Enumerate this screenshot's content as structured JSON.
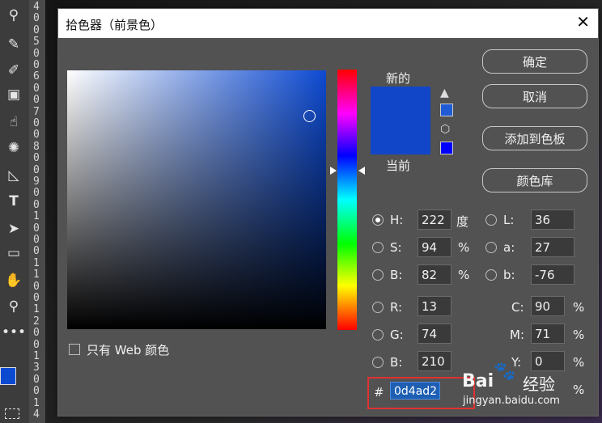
{
  "dialog": {
    "title": "拾色器（前景色）",
    "close": "✕"
  },
  "preview": {
    "new_label": "新的",
    "current_label": "当前",
    "new_color": "#1146c8",
    "current_color": "#1146c8",
    "warning_swatch": "#1f5bd4",
    "websafe_swatch": "#0000ff"
  },
  "buttons": {
    "ok": "确定",
    "cancel": "取消",
    "add_swatch": "添加到色板",
    "color_library": "颜色库"
  },
  "hsb": {
    "h_label": "H:",
    "h_value": "222",
    "h_unit": "度",
    "s_label": "S:",
    "s_value": "94",
    "s_unit": "%",
    "b_label": "B:",
    "b_value": "82",
    "b_unit": "%"
  },
  "lab": {
    "l_label": "L:",
    "l_value": "36",
    "a_label": "a:",
    "a_value": "27",
    "b_label": "b:",
    "b_value": "-76"
  },
  "rgb": {
    "r_label": "R:",
    "r_value": "13",
    "g_label": "G:",
    "g_value": "74",
    "b_label": "B:",
    "b_value": "210"
  },
  "cmyk": {
    "c_label": "C:",
    "c_value": "90",
    "c_unit": "%",
    "m_label": "M:",
    "m_value": "71",
    "m_unit": "%",
    "y_label": "Y:",
    "y_value": "0",
    "y_unit": "%",
    "k_unit": "%"
  },
  "hex": {
    "label": "#",
    "value": "0d4ad2"
  },
  "web_only": {
    "label": "只有 Web 颜色"
  },
  "ruler": {
    "marks": [
      "4",
      "0",
      "0",
      "5",
      "0",
      "0",
      "6",
      "0",
      "0",
      "7",
      "0",
      "0",
      "8",
      "0",
      "0",
      "9",
      "0",
      "0",
      "1",
      "0",
      "0",
      "0",
      "1",
      "1",
      "0",
      "0",
      "1",
      "2",
      "0",
      "0",
      "1",
      "3",
      "0",
      "0",
      "1",
      "4"
    ]
  },
  "watermark": {
    "brand": "Bai",
    "brand_cn": "经验",
    "url": "jingyan.baidu.com"
  },
  "colors": {
    "accent_highlight": "#e03131"
  }
}
